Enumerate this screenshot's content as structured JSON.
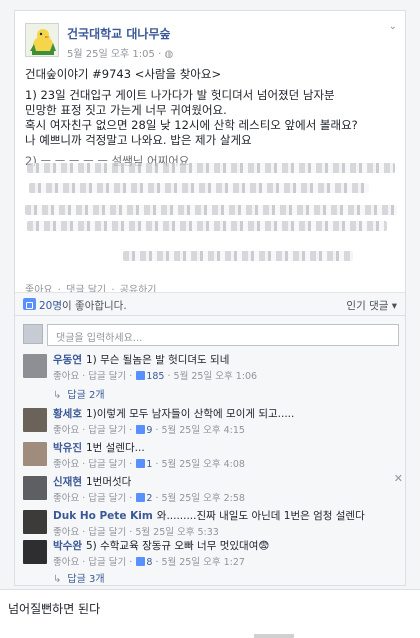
{
  "post": {
    "page_name": "건국대학교 대나무숲",
    "time": "5월 25일 오후 1:05",
    "chevron": "⌄",
    "lines": [
      "건대숲이야기 #9743 <사람을 찾아요>",
      "1) 23일 건대입구 게이트 나가다가 발 헛디뎌서 넘어졌던 남자분",
      "민망한 표정 짓고 가는게 너무 귀여웠어요.",
      "혹시 여자친구 없으면 28일 낮 12시에 산학 레스티오 앞에서 볼래요?",
      "나 예쁘니까 걱정말고 나와요. 밥은 제가 살게요",
      "2) ㅡ ㅡ ㅡ ㅡ ㅡ 설쌤님 어찌어요",
      "ㅡ ㅡ ㅡ 하시면 ㅡ ㅡ 해요. 아니면 ㅡ ㅡ 건대입구 9 ㅡ ㅡ 라고요?"
    ],
    "actions": {
      "like": "좋아요",
      "comment": "댓글 달기",
      "share": "공유하기",
      "sep": " · "
    }
  },
  "likes": {
    "count_text": "20명",
    "suffix": "이 좋아합니다.",
    "sort": "인기 댓글 ▾"
  },
  "comment_input": {
    "placeholder": "댓글을 입력하세요..."
  },
  "comments": [
    {
      "name": "우동연",
      "text": "1) 무슨 될놈은 발 헛디뎌도 되네",
      "likes": "185",
      "time": "5월 25일 오후 1:06",
      "replies": "답글 2개"
    },
    {
      "name": "황세호",
      "text": "1)이렇게 모두 남자들이 산학에 모이게 되고.....",
      "likes": "9",
      "time": "5월 25일 오후 4:15"
    },
    {
      "name": "박유진",
      "text": "1번 설렌다...",
      "likes": "1",
      "time": "5월 25일 오후 4:08"
    },
    {
      "name": "신재현",
      "text": "1번머섯다",
      "likes": "2",
      "time": "5월 25일 오후 2:58"
    },
    {
      "name": "Duk Ho Pete Kim",
      "text": "와.........진짜 내일도 아닌데 1번은 엄청 설렌다",
      "likes": "",
      "time": "5월 25일 오후 5:33"
    },
    {
      "name": "박수완",
      "text": "5) 수학교육 장동규 오빠 너무 멋있대여😨",
      "likes": "8",
      "time": "5월 25일 오후 1:27",
      "replies": "답글 3개"
    }
  ],
  "comment_actions": {
    "like": "좋아요",
    "reply": "답글 달기"
  },
  "footer_text": "넘어질뻔하면 된다"
}
